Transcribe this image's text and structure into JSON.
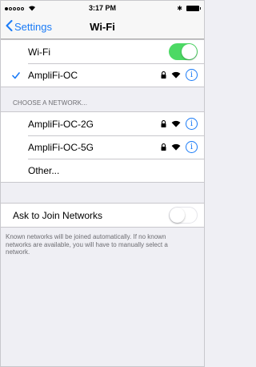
{
  "status_bar": {
    "time": "3:17 PM",
    "bluetooth_symbol": "✱"
  },
  "nav": {
    "back_label": "Settings",
    "title": "Wi-Fi"
  },
  "wifi_toggle": {
    "label": "Wi-Fi",
    "state": "on"
  },
  "connected_network": {
    "name": "AmpliFi-OC",
    "checkmark": "✓",
    "info": "i"
  },
  "choose_header": "CHOOSE A NETWORK...",
  "networks": [
    {
      "name": "AmpliFi-OC-2G",
      "info": "i"
    },
    {
      "name": "AmpliFi-OC-5G",
      "info": "i"
    },
    {
      "name": "Other..."
    }
  ],
  "ask_to_join": {
    "label": "Ask to Join Networks",
    "state": "off",
    "footer": "Known networks will be joined automatically. If no known networks are available, you will have to manually select a network."
  },
  "colors": {
    "accent": "#1a7bf7",
    "toggle_on": "#4cd964",
    "background": "#efeff4"
  }
}
